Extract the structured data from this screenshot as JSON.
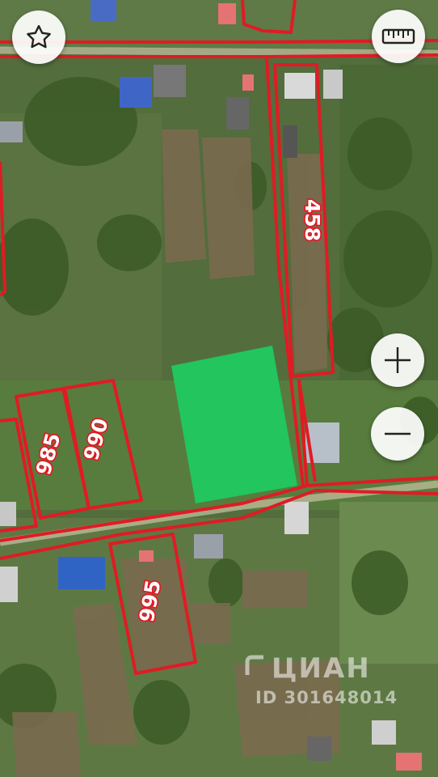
{
  "controls": {
    "favorite_icon": "star-outline-icon",
    "ruler_icon": "ruler-icon",
    "zoom_in_icon": "plus-icon",
    "zoom_out_icon": "minus-icon"
  },
  "parcels": [
    {
      "id": "458",
      "label": "458"
    },
    {
      "id": "985",
      "label": "985"
    },
    {
      "id": "990",
      "label": "990"
    },
    {
      "id": "995",
      "label": "995"
    }
  ],
  "highlighted_plot": {
    "color": "#22c55e"
  },
  "boundary_color": "#e01b24",
  "watermark": {
    "brand": "ЦИАН",
    "id_text": "ID 301648014"
  }
}
